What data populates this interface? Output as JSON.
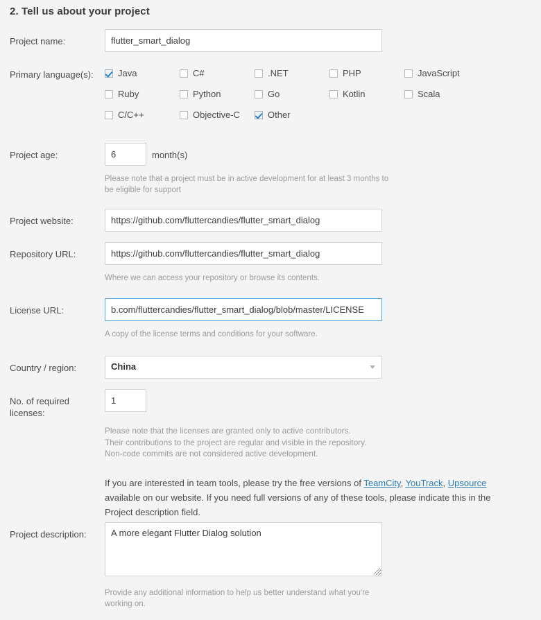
{
  "section": {
    "title": "2. Tell us about your project"
  },
  "fields": {
    "project_name": {
      "label": "Project name:",
      "value": "flutter_smart_dialog"
    },
    "primary_languages": {
      "label": "Primary language(s):",
      "options": [
        {
          "label": "Java",
          "checked": true,
          "col": 0,
          "row": 0
        },
        {
          "label": "C#",
          "checked": false,
          "col": 1,
          "row": 0
        },
        {
          "label": ".NET",
          "checked": false,
          "col": 2,
          "row": 0
        },
        {
          "label": "PHP",
          "checked": false,
          "col": 3,
          "row": 0
        },
        {
          "label": "JavaScript",
          "checked": false,
          "col": 4,
          "row": 0
        },
        {
          "label": "Ruby",
          "checked": false,
          "col": 0,
          "row": 1
        },
        {
          "label": "Python",
          "checked": false,
          "col": 1,
          "row": 1
        },
        {
          "label": "Go",
          "checked": false,
          "col": 2,
          "row": 1
        },
        {
          "label": "Kotlin",
          "checked": false,
          "col": 3,
          "row": 1
        },
        {
          "label": "Scala",
          "checked": false,
          "col": 4,
          "row": 1
        },
        {
          "label": "C/C++",
          "checked": false,
          "col": 0,
          "row": 2
        },
        {
          "label": "Objective-C",
          "checked": false,
          "col": 1,
          "row": 2
        },
        {
          "label": "Other",
          "checked": true,
          "col": 2,
          "row": 2
        }
      ]
    },
    "project_age": {
      "label": "Project age:",
      "value": "6",
      "suffix": "month(s)",
      "hint": "Please note that a project must be in active development for at least 3 months to be eligible for support"
    },
    "project_website": {
      "label": "Project website:",
      "value": "https://github.com/fluttercandies/flutter_smart_dialog"
    },
    "repository_url": {
      "label": "Repository URL:",
      "value": "https://github.com/fluttercandies/flutter_smart_dialog",
      "hint": "Where we can access your repository or browse its contents."
    },
    "license_url": {
      "label": "License URL:",
      "value": "b.com/fluttercandies/flutter_smart_dialog/blob/master/LICENSE",
      "hint": "A copy of the license terms and conditions for your software.",
      "focused": true
    },
    "country_region": {
      "label": "Country / region:",
      "value": "China"
    },
    "required_licenses": {
      "label": "No. of required licenses:",
      "value": "1",
      "notes": [
        "Please note that the licenses are granted only to active contributors.",
        "Their contributions to the project are regular and visible in the repository.",
        "Non-code commits are not considered active development."
      ]
    },
    "team_tools_info": {
      "text_1": "If you are interested in team tools, please try the free versions of ",
      "link_1": "TeamCity",
      "sep_1": ", ",
      "link_2": "YouTrack",
      "sep_2": ", ",
      "link_3": "Upsource",
      "text_2": " available on our website. If you need full versions of any of these tools, please indicate this in the Project description field."
    },
    "project_description": {
      "label": "Project description:",
      "value": "A more elegant Flutter Dialog solution",
      "hint": "Provide any additional information to help us better understand what you're working on."
    }
  },
  "colors": {
    "background": "#f4f4f4",
    "input_border": "#d2d2d2",
    "focus_border": "#4ea6dd",
    "checkmark": "#2a7fc9",
    "link": "#2b7cb5",
    "label_text": "#4a4a4a",
    "hint_text": "#9b9b9b",
    "heading_text": "#3c3c3c"
  }
}
